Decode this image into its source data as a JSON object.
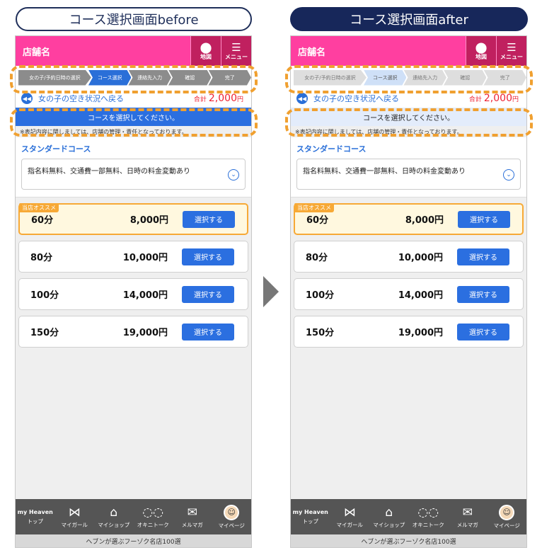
{
  "titles": {
    "before": "コース選択画面before",
    "after": "コース選択画面after"
  },
  "header": {
    "shop_name": "店舗名",
    "map_label": "地図",
    "menu_label": "メニュー"
  },
  "steps": [
    "女の子/予約日時の選択",
    "コース選択",
    "連絡先入力",
    "確認",
    "完了"
  ],
  "back_row": {
    "back_text": "女の子の空き状況へ戻る",
    "total_label": "合計",
    "total_value": "2,000",
    "total_unit": "円"
  },
  "instruction": "コースを選択してください。",
  "notice": "※表記内容に関しましては、店舗の管理・責任となっております。",
  "course": {
    "title": "スタンダードコース",
    "description": "指名料無料、交通費一部無料、日時の料金変動あり"
  },
  "options": [
    {
      "duration": "60分",
      "price": "8,000円",
      "button": "選択する",
      "badge": "当店オススメ"
    },
    {
      "duration": "80分",
      "price": "10,000円",
      "button": "選択する"
    },
    {
      "duration": "100分",
      "price": "14,000円",
      "button": "選択する"
    },
    {
      "duration": "150分",
      "price": "19,000円",
      "button": "選択する"
    }
  ],
  "tabbar": {
    "items": [
      "トップ",
      "マイガール",
      "マイショップ",
      "オキニトーク",
      "メルマガ",
      "マイページ"
    ],
    "logo_text": "my Heaven"
  },
  "footer": "ヘブンが選ぶフーゾク名店100選",
  "colors": {
    "header": "#ff3fa0",
    "header_button": "#c0205f",
    "accent_blue": "#2b6fe0",
    "highlight": "#f0a030",
    "recommend": "#f7a936"
  }
}
